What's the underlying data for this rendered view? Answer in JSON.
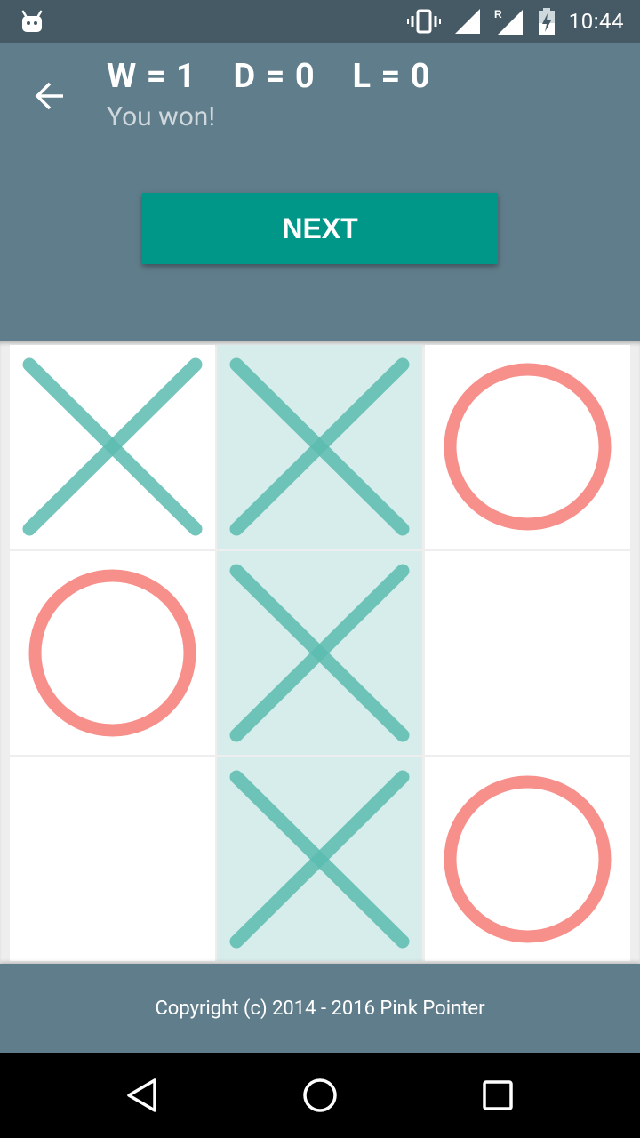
{
  "status_bar": {
    "time": "10:44",
    "icons": [
      "android-icon",
      "vibrate-icon",
      "signal-icon",
      "roaming-signal-icon",
      "battery-charging-icon"
    ],
    "roaming_label": "R"
  },
  "header": {
    "score_text": "W = 1    D = 0    L = 0",
    "result_text": "You won!",
    "back_icon": "arrow-back-icon",
    "next_label": "NEXT"
  },
  "board": {
    "cells": [
      "X",
      "X",
      "O",
      "O",
      "X",
      "",
      "",
      "X",
      "O"
    ],
    "winning_cells": [
      1,
      4,
      7
    ],
    "colors": {
      "x_stroke": "#5cbcb0",
      "o_stroke": "#f78f8a",
      "win_background": "#d6edeb",
      "cell_background": "#ffffff"
    }
  },
  "footer": {
    "copyright": "Copyright (c) 2014 - 2016 Pink Pointer"
  },
  "colors": {
    "status_bar": "#455a64",
    "primary": "#607d8b",
    "accent": "#009688"
  },
  "navigation": {
    "icons": [
      "back-triangle-icon",
      "home-circle-icon",
      "recents-square-icon"
    ]
  }
}
